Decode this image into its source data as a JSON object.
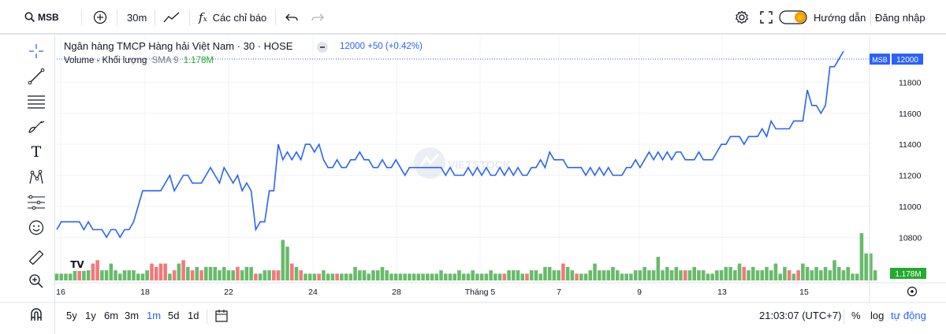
{
  "toolbar": {
    "symbol": "MSB",
    "interval": "30m",
    "indicators_label": "Các chỉ báo",
    "guide_label": "Hướng dẫn",
    "login_label": "Đăng nhập"
  },
  "legend": {
    "title": "Ngân hàng TMCP Hàng hải Việt Nam · 30 · HOSE",
    "price_readout": "12000 +50 (+0.42%)",
    "volume_label": "Volume - Khối lượng",
    "volume_sma": "SMA 9",
    "volume_value": "1.178M"
  },
  "watermark": "VIETSTOCK",
  "price_axis": {
    "ticks": [
      "11800",
      "11600",
      "11400",
      "11200",
      "11000",
      "10800"
    ],
    "symbol_tag": "MSB",
    "last_price": "12000",
    "volume_tag": "1.178M"
  },
  "time_axis": {
    "ticks": [
      "16",
      "18",
      "22",
      "24",
      "28",
      "Tháng 5",
      "7",
      "9",
      "13",
      "15"
    ]
  },
  "bottom": {
    "ranges": [
      "5y",
      "1y",
      "6m",
      "3m",
      "1m",
      "5d",
      "1d"
    ],
    "active_range": "1m",
    "time": "21:03:07 (UTC+7)",
    "percent_label": "%",
    "log_label": "log",
    "auto_label": "tự động"
  },
  "colors": {
    "line": "#2962ff",
    "up": "#26a69a",
    "down": "#ef5350",
    "accent": "#2962ff",
    "volume_up": "#4caf50",
    "volume_down": "#f06262"
  },
  "chart_data": {
    "type": "line",
    "title": "Ngân hàng TMCP Hàng hải Việt Nam · 30 · HOSE",
    "ylim": [
      10700,
      12000
    ],
    "price": [
      10850,
      10900,
      10900,
      10900,
      10900,
      10900,
      10850,
      10900,
      10850,
      10850,
      10850,
      10800,
      10850,
      10850,
      10800,
      10850,
      10850,
      10900,
      11000,
      11100,
      11100,
      11100,
      11100,
      11100,
      11150,
      11200,
      11100,
      11150,
      11200,
      11200,
      11150,
      11150,
      11150,
      11200,
      11250,
      11200,
      11150,
      11250,
      11200,
      11150,
      11200,
      11100,
      11150,
      11100,
      10850,
      10900,
      10900,
      11100,
      11100,
      11400,
      11300,
      11350,
      11300,
      11350,
      11300,
      11400,
      11400,
      11350,
      11400,
      11300,
      11250,
      11250,
      11300,
      11250,
      11250,
      11300,
      11300,
      11350,
      11300,
      11300,
      11250,
      11250,
      11300,
      11250,
      11250,
      11300,
      11250,
      11200,
      11250,
      11250,
      11250,
      11250,
      11250,
      11250,
      11250,
      11250,
      11200,
      11250,
      11200,
      11200,
      11200,
      11250,
      11200,
      11250,
      11200,
      11250,
      11200,
      11200,
      11250,
      11200,
      11250,
      11200,
      11250,
      11200,
      11200,
      11250,
      11250,
      11300,
      11250,
      11350,
      11300,
      11300,
      11300,
      11250,
      11250,
      11250,
      11250,
      11200,
      11250,
      11200,
      11250,
      11200,
      11250,
      11200,
      11200,
      11200,
      11250,
      11250,
      11300,
      11250,
      11300,
      11350,
      11300,
      11350,
      11300,
      11350,
      11300,
      11350,
      11350,
      11300,
      11300,
      11300,
      11350,
      11300,
      11300,
      11300,
      11350,
      11400,
      11400,
      11450,
      11450,
      11450,
      11400,
      11450,
      11450,
      11450,
      11500,
      11450,
      11550,
      11500,
      11500,
      11500,
      11500,
      11550,
      11550,
      11550,
      11750,
      11650,
      11650,
      11600,
      11650,
      11900,
      11900,
      11950,
      12000
    ],
    "volume": [
      2,
      2,
      2,
      2,
      3,
      4,
      3,
      3,
      5,
      6,
      3,
      3,
      5,
      3,
      2,
      3,
      3,
      3,
      2,
      2,
      3,
      5,
      4,
      5,
      5,
      2,
      3,
      5,
      6,
      4,
      3,
      4,
      3,
      4,
      4,
      4,
      3,
      4,
      3,
      3,
      4,
      3,
      4,
      4,
      2,
      2,
      3,
      3,
      3,
      3,
      12,
      10,
      5,
      4,
      3,
      2,
      2,
      2,
      2,
      3,
      2,
      2,
      2,
      2,
      2,
      2,
      4,
      3,
      3,
      2,
      3,
      3,
      4,
      3,
      2,
      2,
      2,
      2,
      2,
      2,
      2,
      2,
      2,
      2,
      2,
      3,
      2,
      2,
      2,
      3,
      2,
      2,
      3,
      2,
      2,
      2,
      3,
      2,
      2,
      2,
      3,
      3,
      3,
      2,
      2,
      3,
      3,
      2,
      4,
      4,
      3,
      3,
      5,
      4,
      3,
      2,
      2,
      2,
      3,
      5,
      3,
      3,
      3,
      4,
      3,
      2,
      2,
      2,
      3,
      3,
      4,
      3,
      3,
      7,
      3,
      4,
      3,
      4,
      3,
      3,
      3,
      4,
      3,
      3,
      2,
      2,
      3,
      3,
      4,
      4,
      3,
      5,
      4,
      3,
      4,
      3,
      3,
      4,
      3,
      5,
      2,
      4,
      3,
      2,
      3,
      5,
      4,
      3,
      4,
      3,
      4,
      3,
      6,
      4,
      3,
      4,
      2,
      2,
      14,
      8,
      8,
      3
    ],
    "volume_down_idx": [
      5,
      8,
      9,
      21,
      22,
      23,
      24,
      26,
      28,
      30,
      32,
      40,
      44,
      48,
      49,
      52,
      54,
      58,
      62,
      99,
      104,
      112,
      115,
      139,
      152,
      162,
      164
    ]
  }
}
